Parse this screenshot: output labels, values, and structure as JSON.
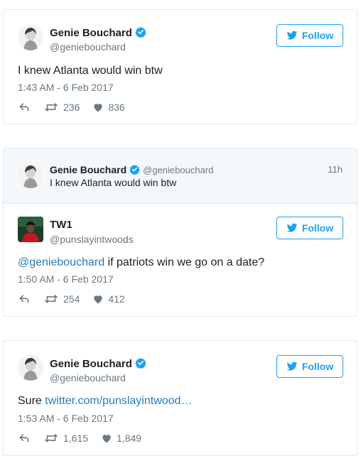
{
  "colors": {
    "accent": "#1da1f2",
    "link": "#2b7bb9",
    "muted": "#697882",
    "border": "#e1e8ed"
  },
  "tweet1": {
    "name": "Genie Bouchard",
    "handle": "@geniebouchard",
    "follow_label": "Follow",
    "text": "I knew Atlanta would win btw",
    "timestamp": "1:43 AM - 6 Feb 2017",
    "retweets": "236",
    "likes": "836"
  },
  "tweet2": {
    "quoted": {
      "name": "Genie Bouchard",
      "handle": "@geniebouchard",
      "time": "11h",
      "text": "I knew Atlanta would win btw"
    },
    "name": "TW1",
    "handle": "@punslayintwoods",
    "follow_label": "Follow",
    "mention": "@geniebouchard",
    "text": " if patriots win we go on a date?",
    "timestamp": "1:50 AM - 6 Feb 2017",
    "retweets": "254",
    "likes": "412"
  },
  "tweet3": {
    "name": "Genie Bouchard",
    "handle": "@geniebouchard",
    "follow_label": "Follow",
    "text_prefix": "Sure ",
    "link": "twitter.com/punslayintwood…",
    "timestamp": "1:53 AM - 6 Feb 2017",
    "retweets": "1,615",
    "likes": "1,849"
  },
  "icons": [
    "verified-icon",
    "twitter-bird-icon",
    "reply-icon",
    "retweet-icon",
    "heart-icon"
  ]
}
